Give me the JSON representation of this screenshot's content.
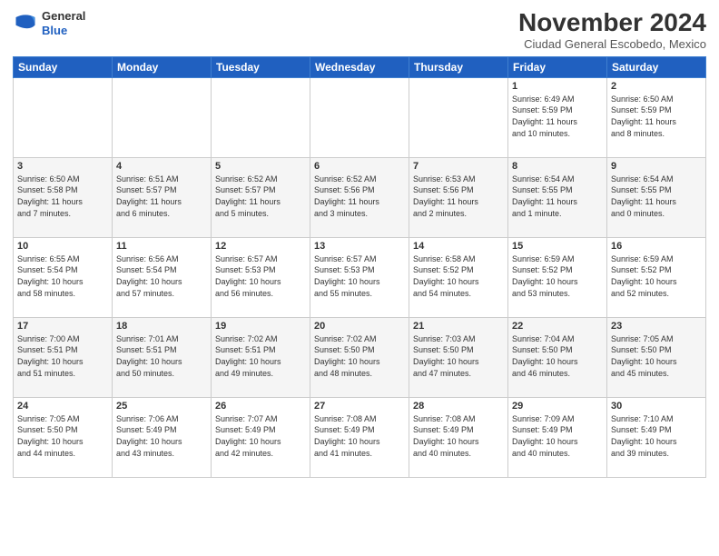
{
  "header": {
    "logo_general": "General",
    "logo_blue": "Blue",
    "month": "November 2024",
    "city": "Ciudad General Escobedo, Mexico"
  },
  "weekdays": [
    "Sunday",
    "Monday",
    "Tuesday",
    "Wednesday",
    "Thursday",
    "Friday",
    "Saturday"
  ],
  "rows": [
    [
      {
        "day": "",
        "info": ""
      },
      {
        "day": "",
        "info": ""
      },
      {
        "day": "",
        "info": ""
      },
      {
        "day": "",
        "info": ""
      },
      {
        "day": "",
        "info": ""
      },
      {
        "day": "1",
        "info": "Sunrise: 6:49 AM\nSunset: 5:59 PM\nDaylight: 11 hours\nand 10 minutes."
      },
      {
        "day": "2",
        "info": "Sunrise: 6:50 AM\nSunset: 5:59 PM\nDaylight: 11 hours\nand 8 minutes."
      }
    ],
    [
      {
        "day": "3",
        "info": "Sunrise: 6:50 AM\nSunset: 5:58 PM\nDaylight: 11 hours\nand 7 minutes."
      },
      {
        "day": "4",
        "info": "Sunrise: 6:51 AM\nSunset: 5:57 PM\nDaylight: 11 hours\nand 6 minutes."
      },
      {
        "day": "5",
        "info": "Sunrise: 6:52 AM\nSunset: 5:57 PM\nDaylight: 11 hours\nand 5 minutes."
      },
      {
        "day": "6",
        "info": "Sunrise: 6:52 AM\nSunset: 5:56 PM\nDaylight: 11 hours\nand 3 minutes."
      },
      {
        "day": "7",
        "info": "Sunrise: 6:53 AM\nSunset: 5:56 PM\nDaylight: 11 hours\nand 2 minutes."
      },
      {
        "day": "8",
        "info": "Sunrise: 6:54 AM\nSunset: 5:55 PM\nDaylight: 11 hours\nand 1 minute."
      },
      {
        "day": "9",
        "info": "Sunrise: 6:54 AM\nSunset: 5:55 PM\nDaylight: 11 hours\nand 0 minutes."
      }
    ],
    [
      {
        "day": "10",
        "info": "Sunrise: 6:55 AM\nSunset: 5:54 PM\nDaylight: 10 hours\nand 58 minutes."
      },
      {
        "day": "11",
        "info": "Sunrise: 6:56 AM\nSunset: 5:54 PM\nDaylight: 10 hours\nand 57 minutes."
      },
      {
        "day": "12",
        "info": "Sunrise: 6:57 AM\nSunset: 5:53 PM\nDaylight: 10 hours\nand 56 minutes."
      },
      {
        "day": "13",
        "info": "Sunrise: 6:57 AM\nSunset: 5:53 PM\nDaylight: 10 hours\nand 55 minutes."
      },
      {
        "day": "14",
        "info": "Sunrise: 6:58 AM\nSunset: 5:52 PM\nDaylight: 10 hours\nand 54 minutes."
      },
      {
        "day": "15",
        "info": "Sunrise: 6:59 AM\nSunset: 5:52 PM\nDaylight: 10 hours\nand 53 minutes."
      },
      {
        "day": "16",
        "info": "Sunrise: 6:59 AM\nSunset: 5:52 PM\nDaylight: 10 hours\nand 52 minutes."
      }
    ],
    [
      {
        "day": "17",
        "info": "Sunrise: 7:00 AM\nSunset: 5:51 PM\nDaylight: 10 hours\nand 51 minutes."
      },
      {
        "day": "18",
        "info": "Sunrise: 7:01 AM\nSunset: 5:51 PM\nDaylight: 10 hours\nand 50 minutes."
      },
      {
        "day": "19",
        "info": "Sunrise: 7:02 AM\nSunset: 5:51 PM\nDaylight: 10 hours\nand 49 minutes."
      },
      {
        "day": "20",
        "info": "Sunrise: 7:02 AM\nSunset: 5:50 PM\nDaylight: 10 hours\nand 48 minutes."
      },
      {
        "day": "21",
        "info": "Sunrise: 7:03 AM\nSunset: 5:50 PM\nDaylight: 10 hours\nand 47 minutes."
      },
      {
        "day": "22",
        "info": "Sunrise: 7:04 AM\nSunset: 5:50 PM\nDaylight: 10 hours\nand 46 minutes."
      },
      {
        "day": "23",
        "info": "Sunrise: 7:05 AM\nSunset: 5:50 PM\nDaylight: 10 hours\nand 45 minutes."
      }
    ],
    [
      {
        "day": "24",
        "info": "Sunrise: 7:05 AM\nSunset: 5:50 PM\nDaylight: 10 hours\nand 44 minutes."
      },
      {
        "day": "25",
        "info": "Sunrise: 7:06 AM\nSunset: 5:49 PM\nDaylight: 10 hours\nand 43 minutes."
      },
      {
        "day": "26",
        "info": "Sunrise: 7:07 AM\nSunset: 5:49 PM\nDaylight: 10 hours\nand 42 minutes."
      },
      {
        "day": "27",
        "info": "Sunrise: 7:08 AM\nSunset: 5:49 PM\nDaylight: 10 hours\nand 41 minutes."
      },
      {
        "day": "28",
        "info": "Sunrise: 7:08 AM\nSunset: 5:49 PM\nDaylight: 10 hours\nand 40 minutes."
      },
      {
        "day": "29",
        "info": "Sunrise: 7:09 AM\nSunset: 5:49 PM\nDaylight: 10 hours\nand 40 minutes."
      },
      {
        "day": "30",
        "info": "Sunrise: 7:10 AM\nSunset: 5:49 PM\nDaylight: 10 hours\nand 39 minutes."
      }
    ]
  ]
}
